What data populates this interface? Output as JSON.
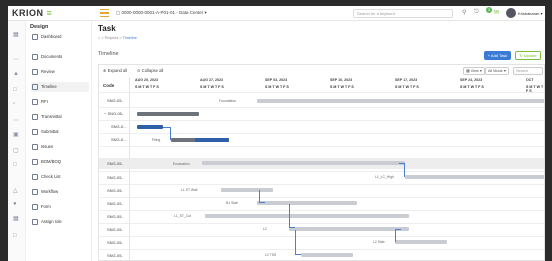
{
  "app": {
    "logo_prefix": "K",
    "logo_main": "RION",
    "logo_suffix": "≡"
  },
  "topbar": {
    "project": "▢ 0000-0000-0001-A-P01-01 - Data Center ▾",
    "search_placeholder": "Search for a keyword",
    "badge": "3",
    "user": "Krisbakaran ▾"
  },
  "sidebar": {
    "heading": "Design",
    "items": [
      {
        "label": "Dashboard"
      },
      {
        "label": "Documents"
      },
      {
        "label": "Review"
      },
      {
        "label": "Timeline",
        "active": true
      },
      {
        "label": "RFI"
      },
      {
        "label": "Transmittal"
      },
      {
        "label": "Submittal"
      },
      {
        "label": "Issues"
      },
      {
        "label": "BOM/BOQ"
      },
      {
        "label": "Check List"
      },
      {
        "label": "Workflow"
      },
      {
        "label": "Form"
      },
      {
        "label": "Assign role"
      }
    ]
  },
  "main": {
    "title": "Task",
    "breadcrumb_home": "⌂ > Projects >",
    "breadcrumb_current": "Timeline",
    "section_title": "Timeline",
    "add_task": "+ Add Task",
    "update": "↻ Update",
    "expand_all": "⊕ Expand all",
    "collapse_all": "⊖ Collapse all",
    "view_label": "▦ View ▾",
    "mode_label": "All Mode ▾",
    "search_placeholder": "Search",
    "code_header": "Code",
    "weeks": [
      "AUG 20, 2023",
      "AUG 27, 2023",
      "SEP 03, 2023",
      "SEP 10, 2023",
      "SEP 17, 2023",
      "SEP 24, 2023",
      "OCT"
    ],
    "days": "S   M   T   W   T   F   S",
    "rows": [
      {
        "code": "SNG-05-"
      },
      {
        "code": "− SNG-05-"
      },
      {
        "code": "SNG-0..."
      },
      {
        "code": "SNG-0..."
      },
      {
        "code": "SNG-05-"
      },
      {
        "code": "SNG-05-"
      },
      {
        "code": "SNG-05-"
      },
      {
        "code": "SNG-05-"
      },
      {
        "code": "SNG-05-"
      },
      {
        "code": "SNG-05-"
      },
      {
        "code": "SNG-05-"
      },
      {
        "code": "SNG-05-"
      },
      {
        "code": "SNG-05-"
      }
    ],
    "bar_labels": {
      "foundation": "Foundation",
      "piling": "Piling",
      "excavation": "Excavation",
      "l1_wall": "L1 ST Wall",
      "b1_slab": "B1 Slab",
      "l1_col": "L1_ST_Col",
      "l2": "L2",
      "l2_slab": "L2 Slab",
      "l2_tss": "L2 TSS",
      "l1_high": "L1_LC_High"
    }
  }
}
